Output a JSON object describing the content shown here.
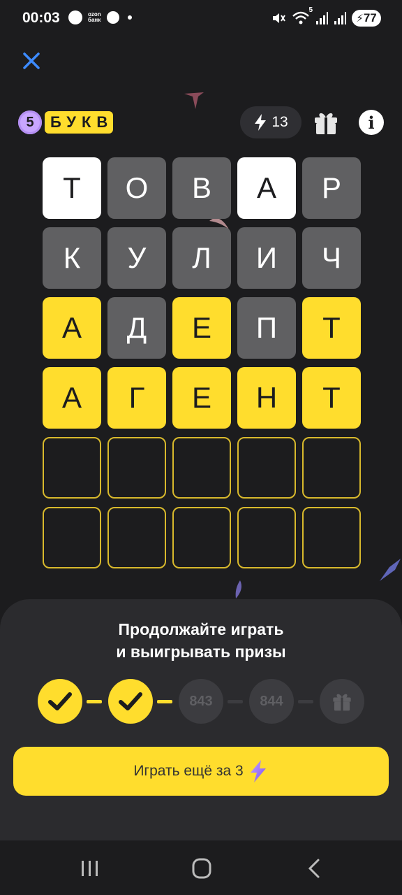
{
  "status": {
    "time": "00:03",
    "ozon_line1": "ozon",
    "ozon_line2": "банк",
    "wifi_badge": "5",
    "battery": "77"
  },
  "header": {
    "logo_number": "5",
    "logo_word": "БУКВ",
    "energy_count": "13"
  },
  "board": {
    "rows": [
      [
        {
          "l": "Т",
          "s": "white"
        },
        {
          "l": "О",
          "s": "gray"
        },
        {
          "l": "В",
          "s": "gray"
        },
        {
          "l": "А",
          "s": "white"
        },
        {
          "l": "Р",
          "s": "gray"
        }
      ],
      [
        {
          "l": "К",
          "s": "gray"
        },
        {
          "l": "У",
          "s": "gray"
        },
        {
          "l": "Л",
          "s": "gray"
        },
        {
          "l": "И",
          "s": "gray"
        },
        {
          "l": "Ч",
          "s": "gray"
        }
      ],
      [
        {
          "l": "А",
          "s": "yellow"
        },
        {
          "l": "Д",
          "s": "gray"
        },
        {
          "l": "Е",
          "s": "yellow"
        },
        {
          "l": "П",
          "s": "gray"
        },
        {
          "l": "Т",
          "s": "yellow"
        }
      ],
      [
        {
          "l": "А",
          "s": "yellow"
        },
        {
          "l": "Г",
          "s": "yellow"
        },
        {
          "l": "Е",
          "s": "yellow"
        },
        {
          "l": "Н",
          "s": "yellow"
        },
        {
          "l": "Т",
          "s": "yellow"
        }
      ],
      [
        {
          "l": "",
          "s": "empty"
        },
        {
          "l": "",
          "s": "empty"
        },
        {
          "l": "",
          "s": "empty"
        },
        {
          "l": "",
          "s": "empty"
        },
        {
          "l": "",
          "s": "empty"
        }
      ],
      [
        {
          "l": "",
          "s": "empty"
        },
        {
          "l": "",
          "s": "empty"
        },
        {
          "l": "",
          "s": "empty"
        },
        {
          "l": "",
          "s": "empty"
        },
        {
          "l": "",
          "s": "empty"
        }
      ]
    ]
  },
  "panel": {
    "title_line1": "Продолжайте играть",
    "title_line2": "и выигрывать призы",
    "steps": [
      {
        "type": "done",
        "label": ""
      },
      {
        "type": "done",
        "label": ""
      },
      {
        "type": "todo",
        "label": "843"
      },
      {
        "type": "todo",
        "label": "844"
      },
      {
        "type": "gift",
        "label": ""
      }
    ],
    "play_button_label": "Играть ещё за 3"
  },
  "colors": {
    "background": "#1c1c1e",
    "accent_yellow": "#ffdd2d",
    "tile_gray": "#606062",
    "close_blue": "#3d8bff"
  },
  "icons": [
    "close-icon",
    "lightning-icon",
    "gift-icon",
    "info-icon",
    "check-icon",
    "recents-icon",
    "home-icon",
    "back-icon"
  ]
}
